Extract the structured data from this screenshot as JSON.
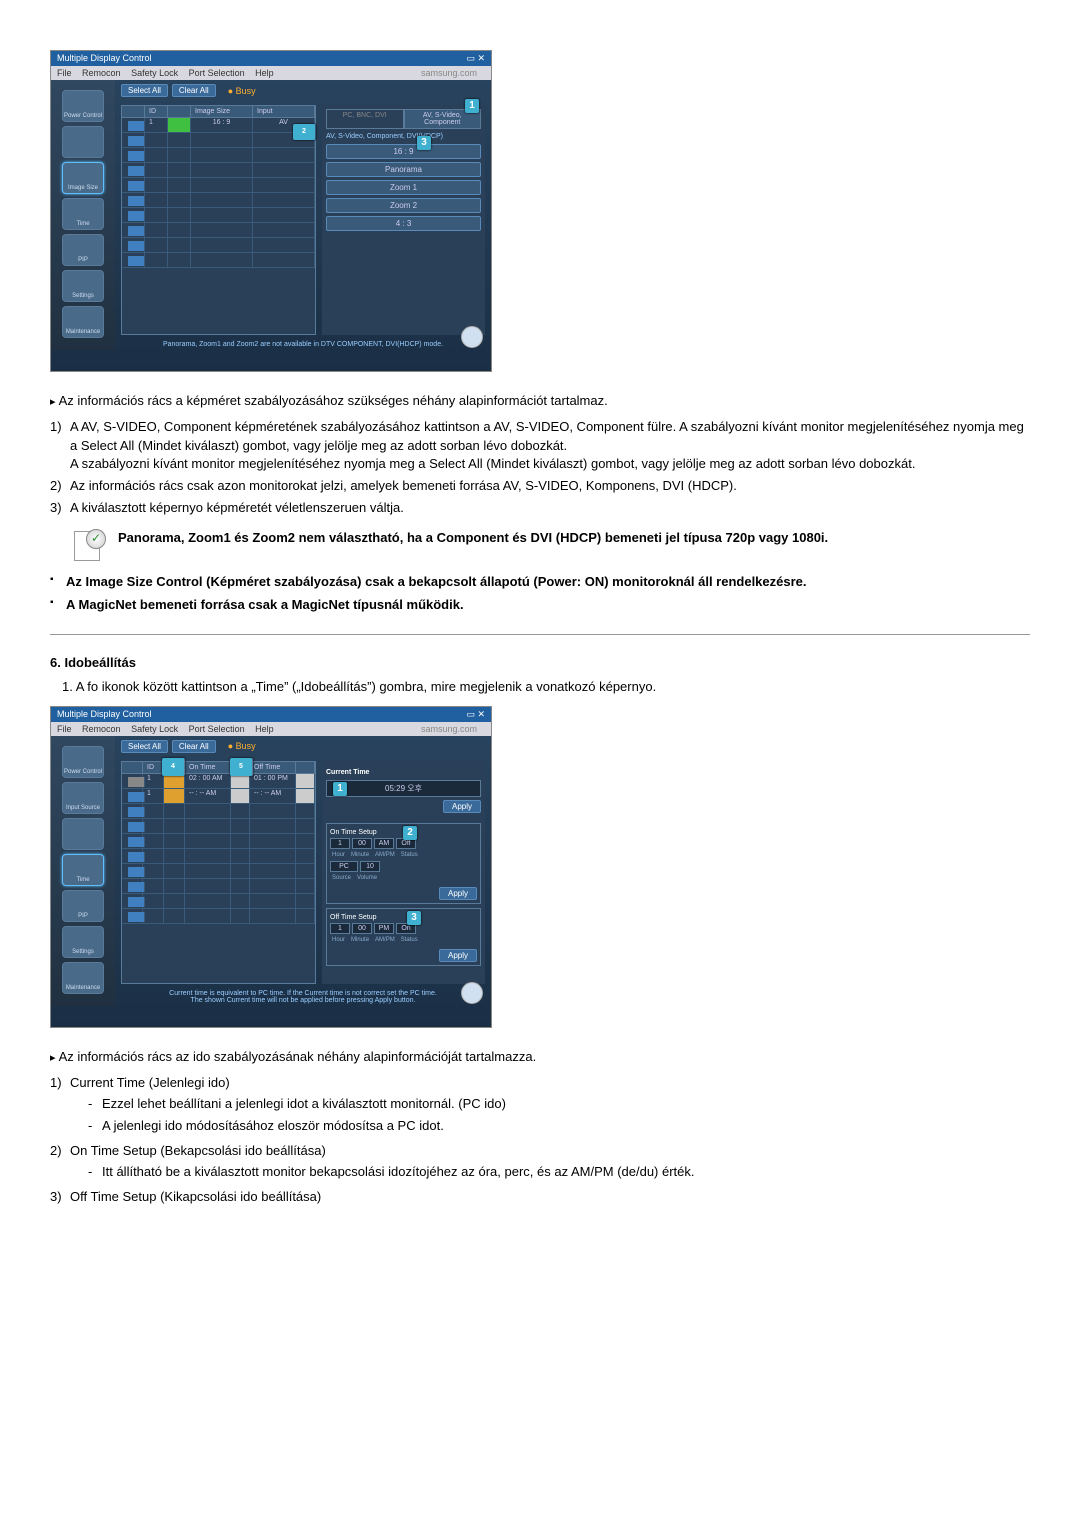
{
  "screenshot1": {
    "title": "Multiple Display Control",
    "menu": [
      "File",
      "Remocon",
      "Safety Lock",
      "Port Selection",
      "Help"
    ],
    "logo": "samsung.com",
    "sidebar": [
      "Power Control",
      "",
      "Image Size",
      "Time",
      "PIP",
      "Settings",
      "Maintenance"
    ],
    "buttons": {
      "select": "Select All",
      "clear": "Clear All",
      "busy": "Busy"
    },
    "grid": {
      "headers": [
        "",
        "ID",
        "",
        "Image Size",
        "Input"
      ],
      "row1": [
        "",
        "1",
        "",
        "16 : 9",
        "AV"
      ]
    },
    "panel": {
      "tab1": "PC, BNC, DVI",
      "tab2": "AV, S-Video, Component",
      "label": "AV, S-Video, Component, DVI(HDCP)",
      "opts": [
        "16 : 9",
        "Panorama",
        "Zoom 1",
        "Zoom 2",
        "4 : 3"
      ]
    },
    "footer": "Panorama, Zoom1 and Zoom2 are not available in DTV COMPONENT, DVI(HDCP) mode.",
    "callouts": {
      "c1": "1",
      "c2": "2",
      "c3": "3"
    }
  },
  "intro1": "Az információs rács a képméret szabályozásához szükséges néhány alapinformációt tartalmaz.",
  "list1": {
    "i1": {
      "n": "1)",
      "t": "A AV, S-VIDEO, Component képméretének szabályozásához kattintson a AV, S-VIDEO, Component fülre. A szabályozni kívánt monitor megjelenítéséhez nyomja meg a Select All (Mindet kiválaszt) gombot, vagy jelölje meg az adott sorban lévo dobozkát.",
      "t2": "A szabályozni kívánt monitor megjelenítéséhez nyomja meg a Select All (Mindet kiválaszt) gombot, vagy jelölje meg az adott sorban lévo dobozkát."
    },
    "i2": {
      "n": "2)",
      "t": "Az információs rács csak azon monitorokat jelzi, amelyek bemeneti forrása AV, S-VIDEO, Komponens, DVI (HDCP)."
    },
    "i3": {
      "n": "3)",
      "t": "A kiválasztott képernyo képméretét véletlenszeruen váltja."
    }
  },
  "note1": "Panorama, Zoom1 és Zoom2 nem választható, ha a Component és DVI (HDCP) bemeneti jel típusa 720p vagy 1080i.",
  "bullets1": {
    "b1": "Az Image Size Control (Képméret szabályozása) csak a bekapcsolt állapotú (Power: ON) monitoroknál áll rendelkezésre.",
    "b2": "A MagicNet bemeneti forrása csak a MagicNet típusnál működik."
  },
  "section6": {
    "head": "6. Idobeállítás",
    "item1": "1.  A fo ikonok között kattintson a „Time” („Idobeállítás”) gombra, mire megjelenik a vonatkozó képernyo."
  },
  "screenshot2": {
    "title": "Multiple Display Control",
    "menu": [
      "File",
      "Remocon",
      "Safety Lock",
      "Port Selection",
      "Help"
    ],
    "logo": "samsung.com",
    "sidebar": [
      "Power Control",
      "Input Source",
      "",
      "Time",
      "PIP",
      "Settings",
      "Maintenance"
    ],
    "buttons": {
      "select": "Select All",
      "clear": "Clear All",
      "busy": "Busy"
    },
    "grid": {
      "headers": [
        "",
        "ID",
        "",
        "On Time",
        "",
        "Off Time",
        ""
      ],
      "row1": [
        "",
        "1",
        "",
        "02 : 00  AM",
        "",
        "01 : 00  PM",
        ""
      ],
      "row2": [
        "",
        "1",
        "",
        "-- : --  AM",
        "",
        "-- : --  AM",
        ""
      ]
    },
    "panel": {
      "cur_label": "Current Time",
      "cur_val": "05:29 오후",
      "apply": "Apply",
      "on_label": "On Time Setup",
      "off_label": "Off Time Setup",
      "tf": {
        "hour": "1",
        "min": "00",
        "ampm": "AM",
        "src": "PC",
        "vol": "10",
        "status_off": "Off",
        "status_on": "On"
      },
      "sub": {
        "hour": "Hour",
        "min": "Minute",
        "ampm": "AM/PM",
        "status": "Status",
        "source": "Source",
        "volume": "Volume"
      }
    },
    "footer1": "Current time is equivalent to PC time. If the Current time is not correct set the PC time.",
    "footer2": "The shown Current time will not be applied before pressing Apply button.",
    "callouts": {
      "c1": "1",
      "c2": "2",
      "c3": "3",
      "c4": "4",
      "c5": "5"
    }
  },
  "intro2": "Az információs rács az ido szabályozásának néhány alapinformációját tartalmazza.",
  "list2": {
    "i1": {
      "n": "1)",
      "t": "Current Time (Jelenlegi ido)",
      "s1": "Ezzel lehet beállítani a jelenlegi idot a kiválasztott monitornál. (PC ido)",
      "s2": "A jelenlegi ido módosításához eloször módosítsa a PC idot."
    },
    "i2": {
      "n": "2)",
      "t": "On Time Setup (Bekapcsolási ido beállítása)",
      "s1": "Itt állítható be a kiválasztott monitor bekapcsolási idozítojéhez az óra, perc, és az AM/PM (de/du) érték."
    },
    "i3": {
      "n": "3)",
      "t": "Off Time Setup (Kikapcsolási ido beállítása)"
    }
  }
}
